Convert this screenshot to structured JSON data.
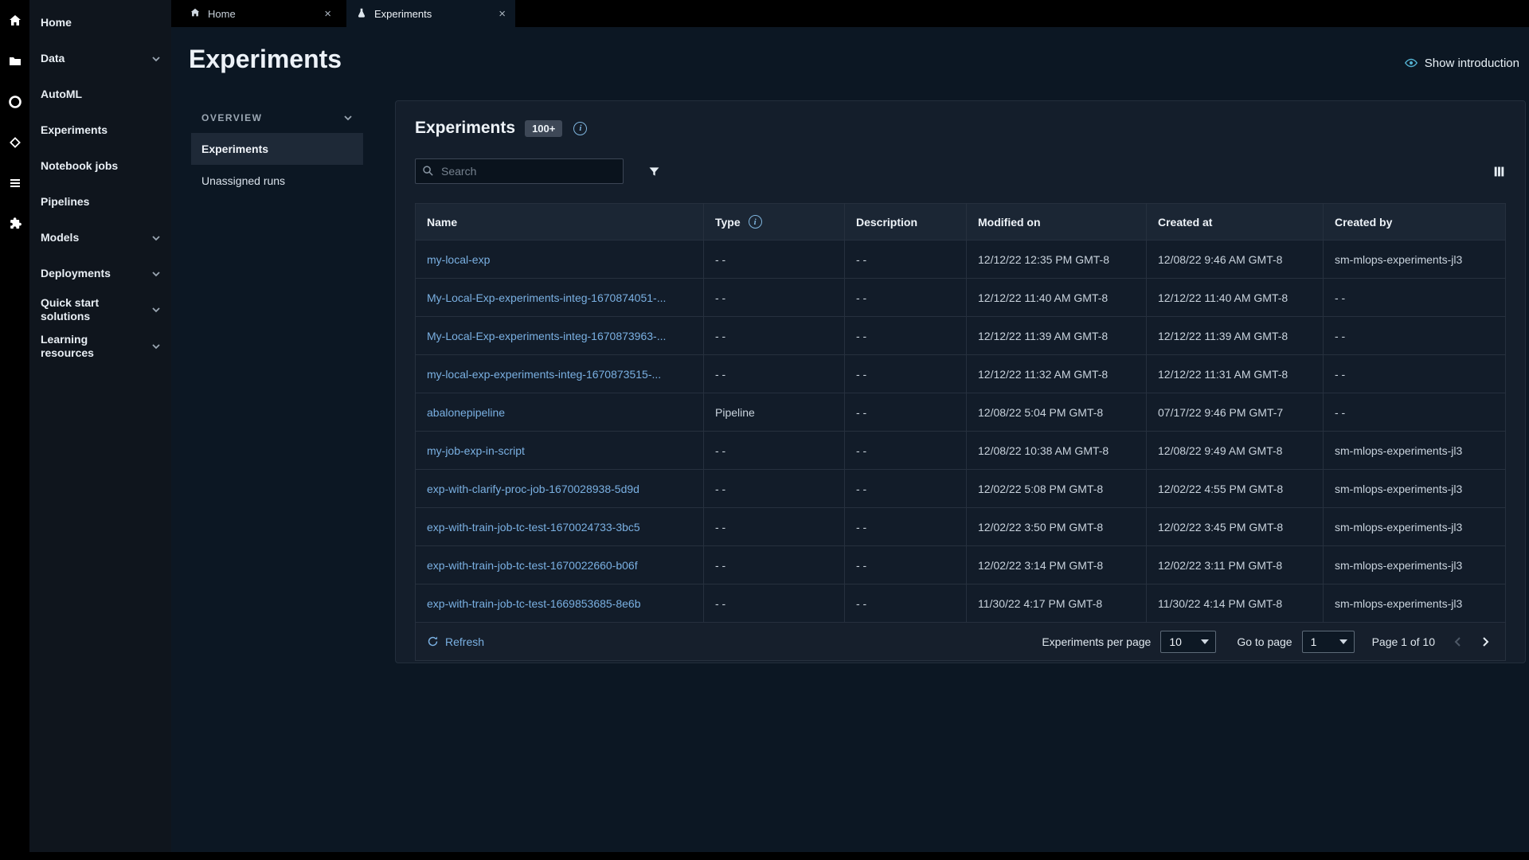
{
  "icons": {
    "close": "×",
    "info": "i"
  },
  "sidebar": {
    "items": [
      {
        "label": "Home"
      },
      {
        "label": "Data"
      },
      {
        "label": "AutoML"
      },
      {
        "label": "Experiments"
      },
      {
        "label": "Notebook jobs"
      },
      {
        "label": "Pipelines"
      },
      {
        "label": "Models"
      },
      {
        "label": "Deployments"
      },
      {
        "label": "Quick start solutions"
      },
      {
        "label": "Learning resources"
      }
    ]
  },
  "tabs": [
    {
      "label": "Home"
    },
    {
      "label": "Experiments",
      "active": true
    }
  ],
  "page": {
    "title": "Experiments",
    "show_introduction": "Show introduction"
  },
  "overview": {
    "section_label": "OVERVIEW",
    "items": [
      {
        "label": "Experiments",
        "active": true
      },
      {
        "label": "Unassigned runs"
      }
    ]
  },
  "panel": {
    "title": "Experiments",
    "count_badge": "100+",
    "search_placeholder": "Search"
  },
  "table": {
    "columns": [
      "Name",
      "Type",
      "Description",
      "Modified on",
      "Created at",
      "Created by"
    ],
    "rows": [
      {
        "name": "my-local-exp",
        "type": "- -",
        "description": "- -",
        "modified_on": "12/12/22 12:35 PM GMT-8",
        "created_at": "12/08/22 9:46 AM GMT-8",
        "created_by": "sm-mlops-experiments-jl3"
      },
      {
        "name": "My-Local-Exp-experiments-integ-1670874051-...",
        "type": "- -",
        "description": "- -",
        "modified_on": "12/12/22 11:40 AM GMT-8",
        "created_at": "12/12/22 11:40 AM GMT-8",
        "created_by": "- -"
      },
      {
        "name": "My-Local-Exp-experiments-integ-1670873963-...",
        "type": "- -",
        "description": "- -",
        "modified_on": "12/12/22 11:39 AM GMT-8",
        "created_at": "12/12/22 11:39 AM GMT-8",
        "created_by": "- -"
      },
      {
        "name": "my-local-exp-experiments-integ-1670873515-...",
        "type": "- -",
        "description": "- -",
        "modified_on": "12/12/22 11:32 AM GMT-8",
        "created_at": "12/12/22 11:31 AM GMT-8",
        "created_by": "- -"
      },
      {
        "name": "abalonepipeline",
        "type": "Pipeline",
        "description": "- -",
        "modified_on": "12/08/22 5:04 PM GMT-8",
        "created_at": "07/17/22 9:46 PM GMT-7",
        "created_by": "- -"
      },
      {
        "name": "my-job-exp-in-script",
        "type": "- -",
        "description": "- -",
        "modified_on": "12/08/22 10:38 AM GMT-8",
        "created_at": "12/08/22 9:49 AM GMT-8",
        "created_by": "sm-mlops-experiments-jl3"
      },
      {
        "name": "exp-with-clarify-proc-job-1670028938-5d9d",
        "type": "- -",
        "description": "- -",
        "modified_on": "12/02/22 5:08 PM GMT-8",
        "created_at": "12/02/22 4:55 PM GMT-8",
        "created_by": "sm-mlops-experiments-jl3"
      },
      {
        "name": "exp-with-train-job-tc-test-1670024733-3bc5",
        "type": "- -",
        "description": "- -",
        "modified_on": "12/02/22 3:50 PM GMT-8",
        "created_at": "12/02/22 3:45 PM GMT-8",
        "created_by": "sm-mlops-experiments-jl3"
      },
      {
        "name": "exp-with-train-job-tc-test-1670022660-b06f",
        "type": "- -",
        "description": "- -",
        "modified_on": "12/02/22 3:14 PM GMT-8",
        "created_at": "12/02/22 3:11 PM GMT-8",
        "created_by": "sm-mlops-experiments-jl3"
      },
      {
        "name": "exp-with-train-job-tc-test-1669853685-8e6b",
        "type": "- -",
        "description": "- -",
        "modified_on": "11/30/22 4:17 PM GMT-8",
        "created_at": "11/30/22 4:14 PM GMT-8",
        "created_by": "sm-mlops-experiments-jl3"
      }
    ]
  },
  "footer": {
    "refresh": "Refresh",
    "per_page_label": "Experiments per page",
    "per_page_value": "10",
    "goto_label": "Go to page",
    "goto_value": "1",
    "page_info": "Page 1 of 10"
  }
}
